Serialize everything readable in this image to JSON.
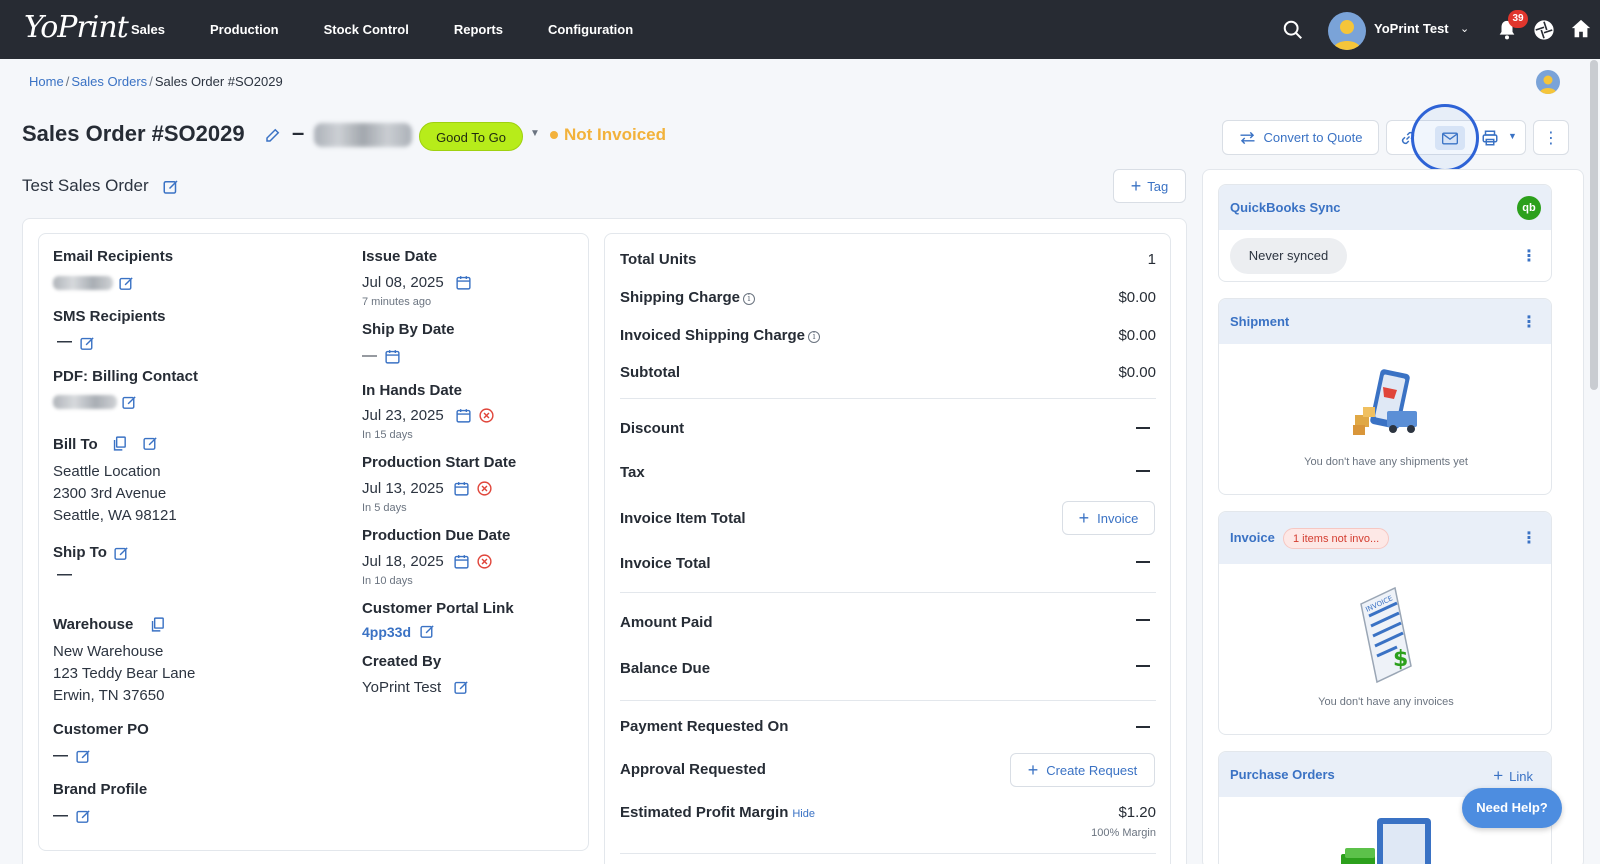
{
  "nav": {
    "logo": "YoPrint",
    "items": [
      "Sales",
      "Production",
      "Stock Control",
      "Reports",
      "Configuration"
    ],
    "user_name": "YoPrint Test",
    "notification_count": "39"
  },
  "breadcrumb": {
    "home": "Home",
    "sales_orders": "Sales Orders",
    "current": "Sales Order #SO2029"
  },
  "header": {
    "title": "Sales Order #SO2029",
    "dash": "–",
    "status": "Good To Go",
    "invoice_status": "Not Invoiced",
    "convert_label": "Convert to Quote",
    "subtitle": "Test Sales Order",
    "tag_label": "Tag"
  },
  "details": {
    "email_recipients": "Email Recipients",
    "sms_recipients": "SMS Recipients",
    "sms_value": "—",
    "pdf_billing": "PDF: Billing Contact",
    "bill_to": "Bill To",
    "bill_to_lines": [
      "Seattle Location",
      "2300 3rd Avenue",
      "Seattle, WA 98121"
    ],
    "ship_to": "Ship To",
    "ship_to_value": "—",
    "warehouse": "Warehouse",
    "warehouse_lines": [
      "New Warehouse",
      "123 Teddy Bear Lane",
      "Erwin, TN 37650"
    ],
    "customer_po": "Customer PO",
    "customer_po_value": "—",
    "brand_profile": "Brand Profile",
    "brand_profile_value": "—"
  },
  "dates": {
    "issue_label": "Issue Date",
    "issue_value": "Jul 08, 2025",
    "issue_note": "7 minutes ago",
    "ship_by_label": "Ship By Date",
    "ship_by_value": "—",
    "in_hands_label": "In Hands Date",
    "in_hands_value": "Jul 23, 2025",
    "in_hands_note": "In 15 days",
    "prod_start_label": "Production Start Date",
    "prod_start_value": "Jul 13, 2025",
    "prod_start_note": "In 5 days",
    "prod_due_label": "Production Due Date",
    "prod_due_value": "Jul 18, 2025",
    "prod_due_note": "In 10 days",
    "portal_label": "Customer Portal Link",
    "portal_value": "4pp33d",
    "created_by_label": "Created By",
    "created_by_value": "YoPrint Test"
  },
  "summary": {
    "total_units_label": "Total Units",
    "total_units_value": "1",
    "shipping_label": "Shipping Charge",
    "shipping_value": "$0.00",
    "inv_shipping_label": "Invoiced Shipping Charge",
    "inv_shipping_value": "$0.00",
    "subtotal_label": "Subtotal",
    "subtotal_value": "$0.00",
    "discount_label": "Discount",
    "tax_label": "Tax",
    "invoice_item_total_label": "Invoice Item Total",
    "invoice_button": "Invoice",
    "invoice_total_label": "Invoice Total",
    "amount_paid_label": "Amount Paid",
    "balance_due_label": "Balance Due",
    "payment_requested_label": "Payment Requested On",
    "approval_label": "Approval Requested",
    "create_request_button": "Create Request",
    "profit_label": "Estimated Profit Margin",
    "profit_hide": "Hide",
    "profit_value": "$1.20",
    "profit_margin": "100% Margin"
  },
  "sidebar": {
    "quickbooks_title": "QuickBooks Sync",
    "quickbooks_icon": "qb",
    "never_synced": "Never synced",
    "shipment_title": "Shipment",
    "shipment_empty": "You don't have any shipments yet",
    "invoice_title": "Invoice",
    "invoice_badge": "1 items not invo...",
    "invoice_empty": "You don't have any invoices",
    "po_title": "Purchase Orders",
    "po_link": "Link"
  },
  "help_button": "Need Help?",
  "colors": {
    "navbar": "#272b33",
    "accent": "#3a72c4",
    "status_green": "#b7ec1a",
    "invoice_orange": "#f2b23b"
  }
}
